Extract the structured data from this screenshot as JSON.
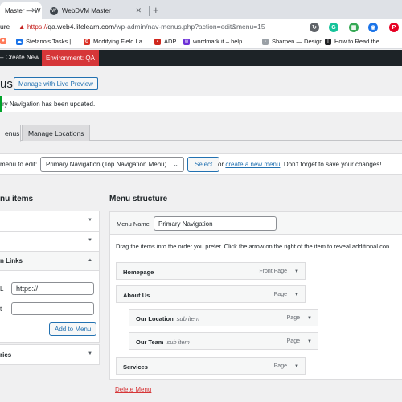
{
  "browser": {
    "tabs": [
      {
        "label": "Master — W"
      },
      {
        "label": "WebDVM Master"
      }
    ],
    "address": {
      "scheme": "https://",
      "host": "qa.web4.lifelearn.com",
      "path": "/wp-admin/nav-menus.php?action=edit&menu=15"
    },
    "left_fragment": "ure",
    "extensions": [
      "sync-icon",
      "grammarly-icon",
      "grid-icon",
      "pinterest-icon"
    ],
    "bookmarks": [
      {
        "label": "Stefano's Tasks |..."
      },
      {
        "label": "Modifying Field La..."
      },
      {
        "label": "ADP"
      },
      {
        "label": "wordmark.it – help..."
      },
      {
        "label": "Sharpen — Design..."
      },
      {
        "label": "How to Read the..."
      }
    ]
  },
  "adminbar": {
    "create_new": "– Create New",
    "environment": "Environment: QA"
  },
  "page": {
    "title": "us",
    "live_preview": "Manage with Live Preview",
    "notice": "ry Navigation has been updated.",
    "tabs": [
      {
        "label": "enus"
      },
      {
        "label": "Manage Locations"
      }
    ],
    "select_label": "menu to edit:",
    "select_value": "Primary Navigation (Top Navigation Menu)",
    "select_button": "Select",
    "or_text": "or",
    "create_link": "create a new menu",
    "save_reminder": ". Don't forget to save your changes!"
  },
  "add_items": {
    "title": "nu items",
    "custom_links_header": "n Links",
    "url_label": "L",
    "url_value": "https://",
    "link_text_label": "t",
    "add_button": "Add to Menu",
    "categories_header": "ries"
  },
  "structure": {
    "title": "Menu structure",
    "menu_name_label": "Menu Name",
    "menu_name_value": "Primary Navigation",
    "instructions": "Drag the items into the order you prefer. Click the arrow on the right of the item to reveal additional con",
    "items": [
      {
        "title": "Homepage",
        "sub": "",
        "type": "Front Page"
      },
      {
        "title": "About Us",
        "sub": "",
        "type": "Page"
      },
      {
        "title": "Our Location",
        "sub": "sub item",
        "type": "Page"
      },
      {
        "title": "Our Team",
        "sub": "sub item",
        "type": "Page"
      },
      {
        "title": "Services",
        "sub": "",
        "type": "Page"
      }
    ],
    "delete_menu": "Delete Menu"
  },
  "colors": {
    "admin_bar": "#1d2327",
    "env_badge": "#d63638",
    "link_blue": "#2271b1",
    "success_green": "#00a32a",
    "delete_red": "#d63638"
  }
}
